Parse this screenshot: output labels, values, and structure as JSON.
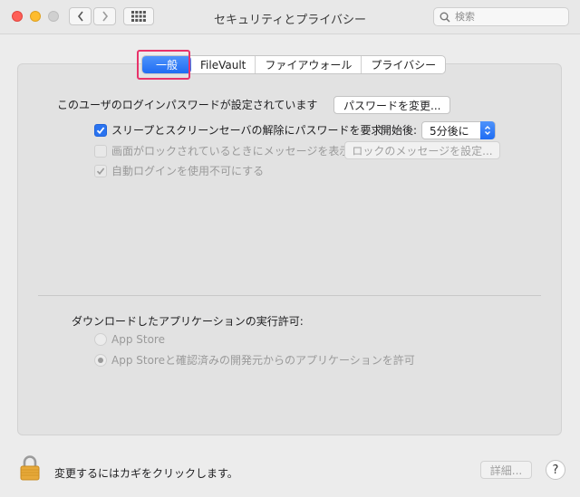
{
  "window": {
    "title": "セキュリティとプライバシー",
    "search_placeholder": "検索"
  },
  "tabs": [
    {
      "label": "一般",
      "active": true
    },
    {
      "label": "FileVault",
      "active": false
    },
    {
      "label": "ファイアウォール",
      "active": false
    },
    {
      "label": "プライバシー",
      "active": false
    }
  ],
  "general": {
    "password_label": "このユーザのログインパスワードが設定されています",
    "change_password_button": "パスワードを変更...",
    "require_password_label": "スリープとスクリーンセーバの解除にパスワードを要求",
    "start_label": "開始後:",
    "start_value": "5分後に",
    "lock_message_label": "画面がロックされているときにメッセージを表示",
    "set_lock_message_button": "ロックのメッセージを設定...",
    "disable_autologin_label": "自動ログインを使用不可にする",
    "downloads_heading": "ダウンロードしたアプリケーションの実行許可:",
    "option_app_store": "App Store",
    "option_app_store_identified": "App Storeと確認済みの開発元からのアプリケーションを許可"
  },
  "footer": {
    "lock_text": "変更するにはカギをクリックします。",
    "advanced_button": "詳細...",
    "help_label": "?"
  },
  "colors": {
    "accent": "#1f6cf3",
    "highlight": "#e8336a"
  }
}
